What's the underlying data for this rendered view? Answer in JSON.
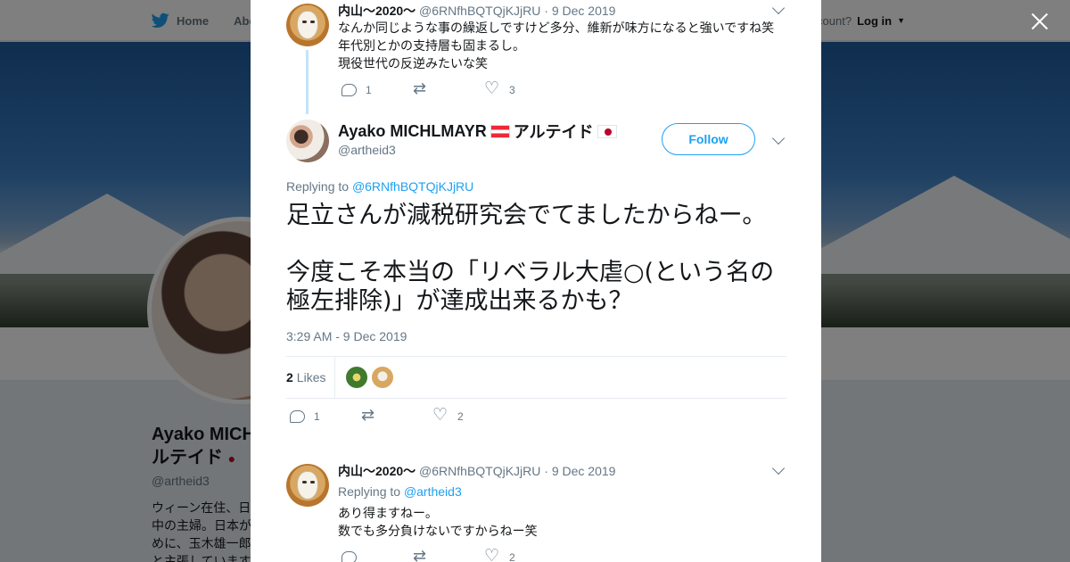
{
  "nav": {
    "home_label": "Home",
    "about_label": "Abo",
    "account_label": "ccount?",
    "login_label": "Log in"
  },
  "profile": {
    "name": "Ayako MICHLMAYR·ルテイド",
    "name_line1": "Ayako MICH",
    "name_line2": "ルテイド",
    "handle": "@artheid3",
    "bio_lines": [
      "ウィーン在住、日",
      "中の主婦。日本が",
      "めに、玉木雄一郎",
      "と主張しています"
    ]
  },
  "parent_tweet": {
    "name": "内山～2020～",
    "handle": "@6RNfhBQTQjKJjRU",
    "date": "9 Dec 2019",
    "lines": [
      "なんか同じような事の繰返しですけど多分、維新が味方になると強いですね笑",
      "年代別とかの支持層も固まるし。",
      "現役世代の反逆みたいな笑"
    ],
    "reply_count": "1",
    "retweet_count": "",
    "like_count": "3"
  },
  "main_tweet": {
    "name": "Ayako MICHLMAYR",
    "name_suffix": "アルテイド",
    "handle": "@artheid3",
    "follow_label": "Follow",
    "replying_prefix": "Replying to",
    "replying_to": "@6RNfhBQTQjKJjRU",
    "text": "足立さんが減税研究会でてましたからねー。\n\n今度こそ本当の「リベラル大虐○(という名の極左排除)」が達成出来るかも？",
    "timestamp": "3:29 AM - 9 Dec 2019",
    "likes_count": "2",
    "likes_label": "Likes",
    "reply_count": "1",
    "retweet_count": "",
    "like_count": "2"
  },
  "reply_tweet": {
    "name": "内山～2020～",
    "handle": "@6RNfhBQTQjKJjRU",
    "date": "9 Dec 2019",
    "replying_prefix": "Replying to",
    "replying_to": "@artheid3",
    "lines": [
      "あり得ますねー。",
      "数でも多分負けないですからねー笑"
    ],
    "reply_count": "",
    "retweet_count": "",
    "like_count": "2"
  },
  "colors": {
    "accent": "#1da1f2",
    "text": "#14171a",
    "muted": "#657786",
    "thread_line": "#c4e3f9"
  }
}
